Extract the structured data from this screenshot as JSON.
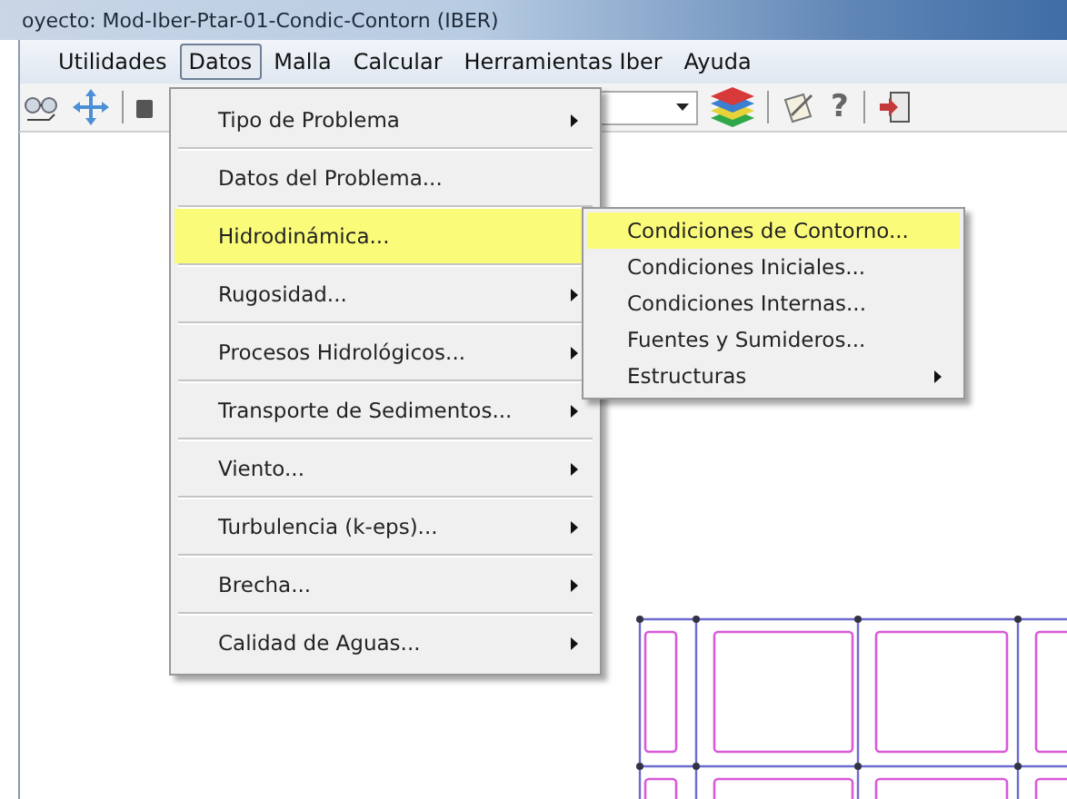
{
  "window": {
    "title": "oyecto: Mod-Iber-Ptar-01-Condic-Contorn (IBER)"
  },
  "menu_bar": [
    {
      "label": "Utilidades",
      "selected": false
    },
    {
      "label": "Datos",
      "selected": true
    },
    {
      "label": "Malla",
      "selected": false
    },
    {
      "label": "Calcular",
      "selected": false
    },
    {
      "label": "Herramientas Iber",
      "selected": false
    },
    {
      "label": "Ayuda",
      "selected": false
    }
  ],
  "toolbar": {
    "help_label": "?"
  },
  "datos_menu": [
    {
      "label": "Tipo de Problema",
      "selected": false,
      "submenu": true
    },
    {
      "label": "Datos del Problema...",
      "selected": false,
      "submenu": false
    },
    {
      "label": "Hidrodinámica...",
      "selected": true,
      "submenu": false
    },
    {
      "label": "Rugosidad...",
      "selected": false,
      "submenu": true
    },
    {
      "label": "Procesos Hidrológicos...",
      "selected": false,
      "submenu": true
    },
    {
      "label": "Transporte de Sedimentos...",
      "selected": false,
      "submenu": true
    },
    {
      "label": "Viento...",
      "selected": false,
      "submenu": true
    },
    {
      "label": "Turbulencia (k-eps)...",
      "selected": false,
      "submenu": true
    },
    {
      "label": "Brecha...",
      "selected": false,
      "submenu": true
    },
    {
      "label": "Calidad de Aguas...",
      "selected": false,
      "submenu": true
    }
  ],
  "hidrodinamica_menu": [
    {
      "label": "Condiciones de Contorno...",
      "selected": true,
      "submenu": false
    },
    {
      "label": "Condiciones Iniciales...",
      "selected": false,
      "submenu": false
    },
    {
      "label": "Condiciones Internas...",
      "selected": false,
      "submenu": false
    },
    {
      "label": "Fuentes y Sumideros...",
      "selected": false,
      "submenu": false
    },
    {
      "label": "Estructuras",
      "selected": false,
      "submenu": true
    }
  ]
}
